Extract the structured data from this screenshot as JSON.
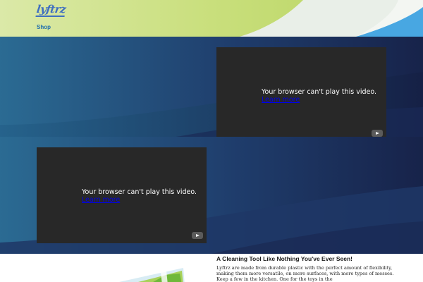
{
  "header": {
    "logo_text": "lyftrz",
    "nav": {
      "shop_label": "Shop"
    },
    "colors": {
      "green": "#c5dc72",
      "white": "#f3f6f2",
      "blue": "#48a7e2"
    }
  },
  "banners": {
    "colors": {
      "light_blue": "#2b6b93",
      "dark_navy": "#18254a"
    },
    "video_1": {
      "message": "Your browser can't play this video.",
      "link_label": "Learn more",
      "icon": "youtube-icon"
    },
    "video_2": {
      "message": "Your browser can't play this video.",
      "link_label": "Learn more",
      "icon": "youtube-icon"
    }
  },
  "product": {
    "title": "A Cleaning Tool Like Nothing You've Ever Seen!",
    "description": "Lyftrz are made from durable plastic with the perfect amount of flexibility, making them more versatile, on more surfaces, with more types of messes. Keep a few in the kitchen. One for the toys in the"
  }
}
